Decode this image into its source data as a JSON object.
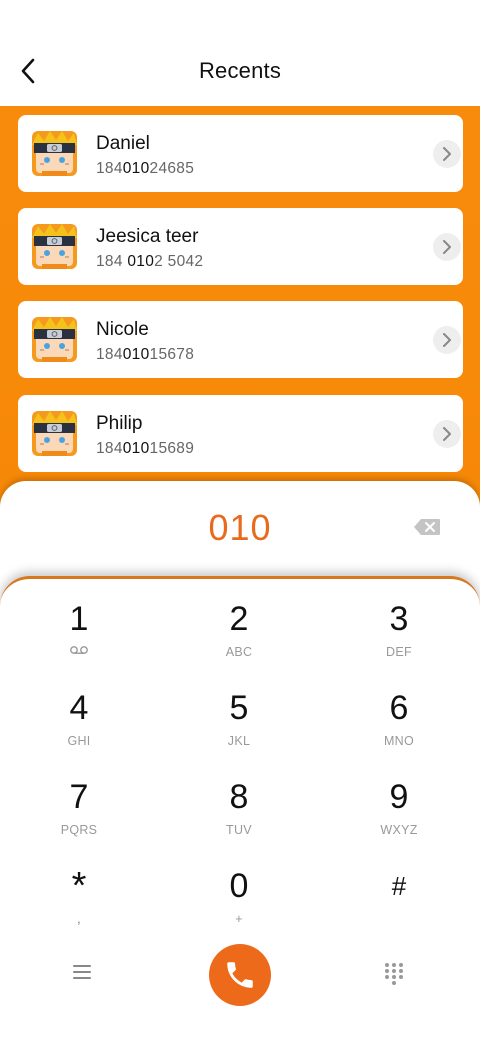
{
  "header": {
    "title": "Recents",
    "back_icon": "chevron-left-icon"
  },
  "contacts": [
    {
      "name": "Daniel",
      "number_pre": "184",
      "number_hl": "010",
      "number_post": "24685"
    },
    {
      "name": "Jeesica teer",
      "number_pre": "184 ",
      "number_hl": "010",
      "number_post": "2 5042"
    },
    {
      "name": "Nicole",
      "number_pre": "184",
      "number_hl": "010",
      "number_post": "15678"
    },
    {
      "name": "Philip",
      "number_pre": "184",
      "number_hl": "010",
      "number_post": "15689"
    }
  ],
  "dialer": {
    "input": "010",
    "keys": [
      {
        "digit": "1",
        "letters": ""
      },
      {
        "digit": "2",
        "letters": "ABC"
      },
      {
        "digit": "3",
        "letters": "DEF"
      },
      {
        "digit": "4",
        "letters": "GHI"
      },
      {
        "digit": "5",
        "letters": "JKL"
      },
      {
        "digit": "6",
        "letters": "MNO"
      },
      {
        "digit": "7",
        "letters": "PQRS"
      },
      {
        "digit": "8",
        "letters": "TUV"
      },
      {
        "digit": "9",
        "letters": "WXYZ"
      },
      {
        "digit": "*",
        "letters": ","
      },
      {
        "digit": "0",
        "letters": "+"
      },
      {
        "digit": "#",
        "letters": ""
      }
    ]
  },
  "colors": {
    "accent": "#ee6a1b",
    "orange_bg": "#f98b0c",
    "dialed_text": "#e86b1d"
  }
}
